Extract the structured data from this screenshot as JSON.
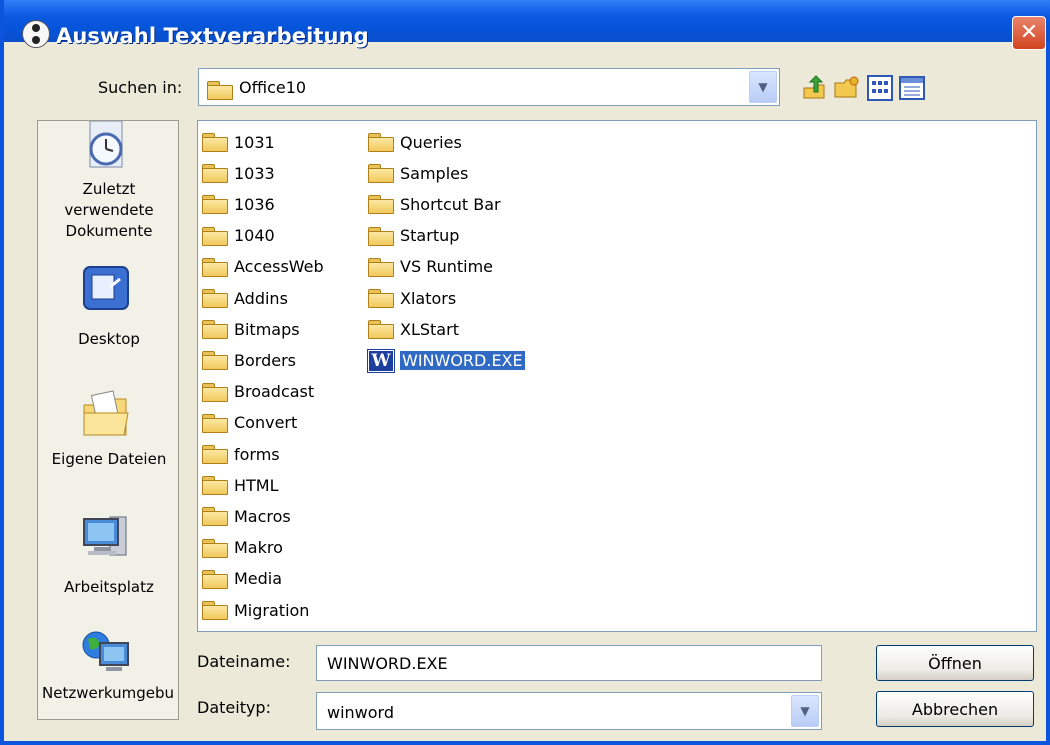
{
  "window": {
    "title": "Auswahl Textverarbeitung",
    "close_glyph": "✕"
  },
  "lookin": {
    "label": "Suchen in:",
    "value": "Office10"
  },
  "toolbar": {
    "icons": [
      "back-up-folder-icon",
      "new-folder-icon",
      "list-view-icon",
      "details-view-icon"
    ]
  },
  "places": [
    {
      "label_lines": [
        "Zuletzt",
        "verwendete",
        "Dokumente"
      ],
      "icon": "recent-documents-icon"
    },
    {
      "label_lines": [
        "Desktop"
      ],
      "icon": "desktop-icon"
    },
    {
      "label_lines": [
        "Eigene Dateien"
      ],
      "icon": "my-documents-icon"
    },
    {
      "label_lines": [
        "Arbeitsplatz"
      ],
      "icon": "my-computer-icon"
    },
    {
      "label_lines": [
        "Netzwerkumgebu"
      ],
      "icon": "network-icon"
    }
  ],
  "files": {
    "column1": [
      "1031",
      "1033",
      "1036",
      "1040",
      "AccessWeb",
      "Addins",
      "Bitmaps",
      "Borders",
      "Broadcast",
      "Convert",
      "forms",
      "HTML",
      "Macros",
      "Makro",
      "Media",
      "Migration"
    ],
    "column2": [
      "Queries",
      "Samples",
      "Shortcut Bar",
      "Startup",
      "VS Runtime",
      "Xlators",
      "XLStart"
    ],
    "selected_file": "WINWORD.EXE",
    "selected_icon_letter": "W"
  },
  "filename": {
    "label": "Dateiname:",
    "value": "WINWORD.EXE"
  },
  "filetype": {
    "label": "Dateityp:",
    "value": "winword"
  },
  "buttons": {
    "open": "Öffnen",
    "cancel": "Abbrechen"
  },
  "colors": {
    "titlebar": "#0a58e0",
    "selection": "#316ac5",
    "dialog_bg": "#ece9d8"
  }
}
